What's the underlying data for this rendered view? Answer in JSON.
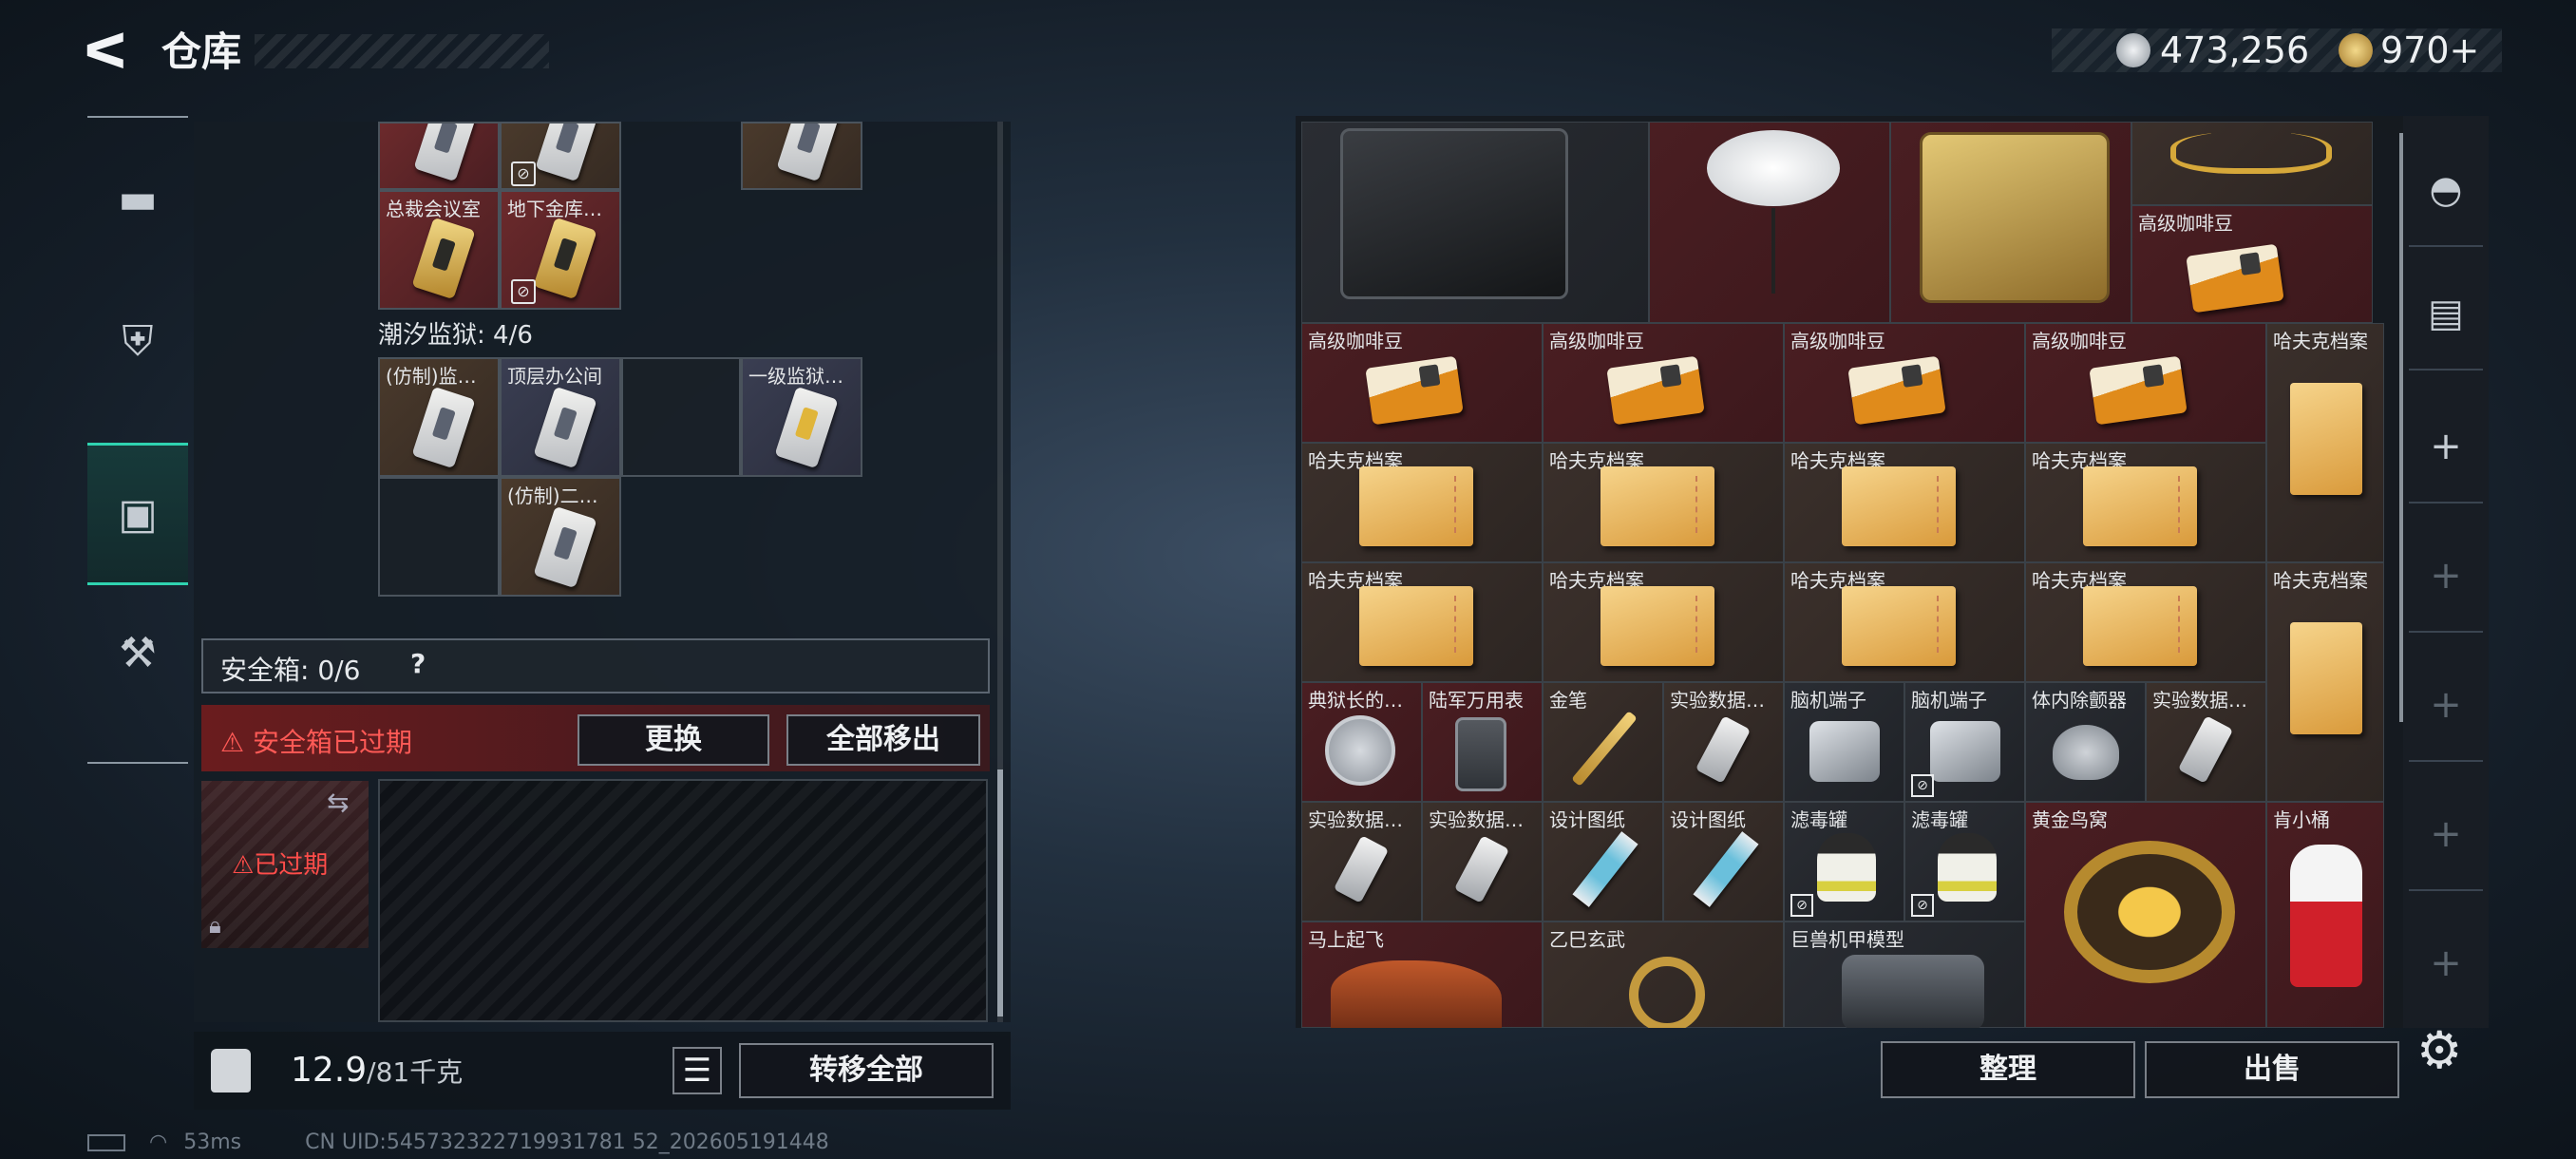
{
  "header": {
    "back_glyph": "ᐸ",
    "title": "仓库"
  },
  "currency": {
    "silver_amount": "473,256",
    "gold_amount": "970+"
  },
  "left_rail": {
    "items": [
      {
        "name": "weapons",
        "icon": "gun-icon",
        "glyph": "▬"
      },
      {
        "name": "equipment",
        "icon": "vest-icon",
        "glyph": "⛨"
      },
      {
        "name": "backpack",
        "icon": "backpack-icon",
        "glyph": "▣"
      },
      {
        "name": "toolbox",
        "icon": "briefcase-icon",
        "glyph": "⚒"
      }
    ],
    "active_index": 2
  },
  "keycard_section": {
    "top_row_labels": [
      "总裁会议室",
      "地下金库…"
    ],
    "prison_heading": "潮汐监狱: 4/6",
    "prison_labels": [
      "(仿制)监…",
      "顶层办公间",
      "一级监狱…",
      "(仿制)二…"
    ]
  },
  "safebox": {
    "label": "安全箱: 0/6",
    "help": "?",
    "expired_text": "⚠ 安全箱已过期",
    "swap_button": "更换",
    "move_all_button": "全部移出",
    "case_expired": "⚠已过期"
  },
  "left_footer": {
    "weight_current": "12.9",
    "weight_max": "/81千克",
    "list_glyph": "☰",
    "transfer_all": "转移全部"
  },
  "stash": {
    "coffee_label": "高级咖啡豆",
    "file_label": "哈夫克档案",
    "row5_labels": [
      "典狱长的…",
      "陆军万用表",
      "金笔",
      "实验数据…",
      "脑机端子",
      "脑机端子",
      "体内除颤器",
      "实验数据…"
    ],
    "row6_labels": [
      "实验数据…",
      "实验数据…",
      "设计图纸",
      "设计图纸",
      "滤毒罐",
      "滤毒罐",
      "黄金鸟窝",
      "肯小桶"
    ],
    "row7_labels": [
      "马上起飞",
      "乙巳玄武",
      "巨兽机甲模型"
    ]
  },
  "right_rail": {
    "items": [
      {
        "icon": "helmet-icon",
        "glyph": "◓"
      },
      {
        "icon": "safebox-icon",
        "glyph": "▤"
      },
      {
        "icon": "add-icon",
        "glyph": "+"
      },
      {
        "icon": "add-icon",
        "glyph": "+"
      },
      {
        "icon": "add-icon",
        "glyph": "+"
      },
      {
        "icon": "add-icon",
        "glyph": "+"
      },
      {
        "icon": "add-icon",
        "glyph": "+"
      }
    ]
  },
  "bottom_buttons": {
    "sort": "整理",
    "sell": "出售",
    "settings_glyph": "⚙"
  },
  "status_bar": {
    "ping": "53ms",
    "uid": "CN UID:545732322719931781 52_202605191448"
  },
  "colors": {
    "accent_teal": "#2fd3b0",
    "warning_red": "#ff5a56",
    "item_red_bg": "#4a1e22"
  }
}
